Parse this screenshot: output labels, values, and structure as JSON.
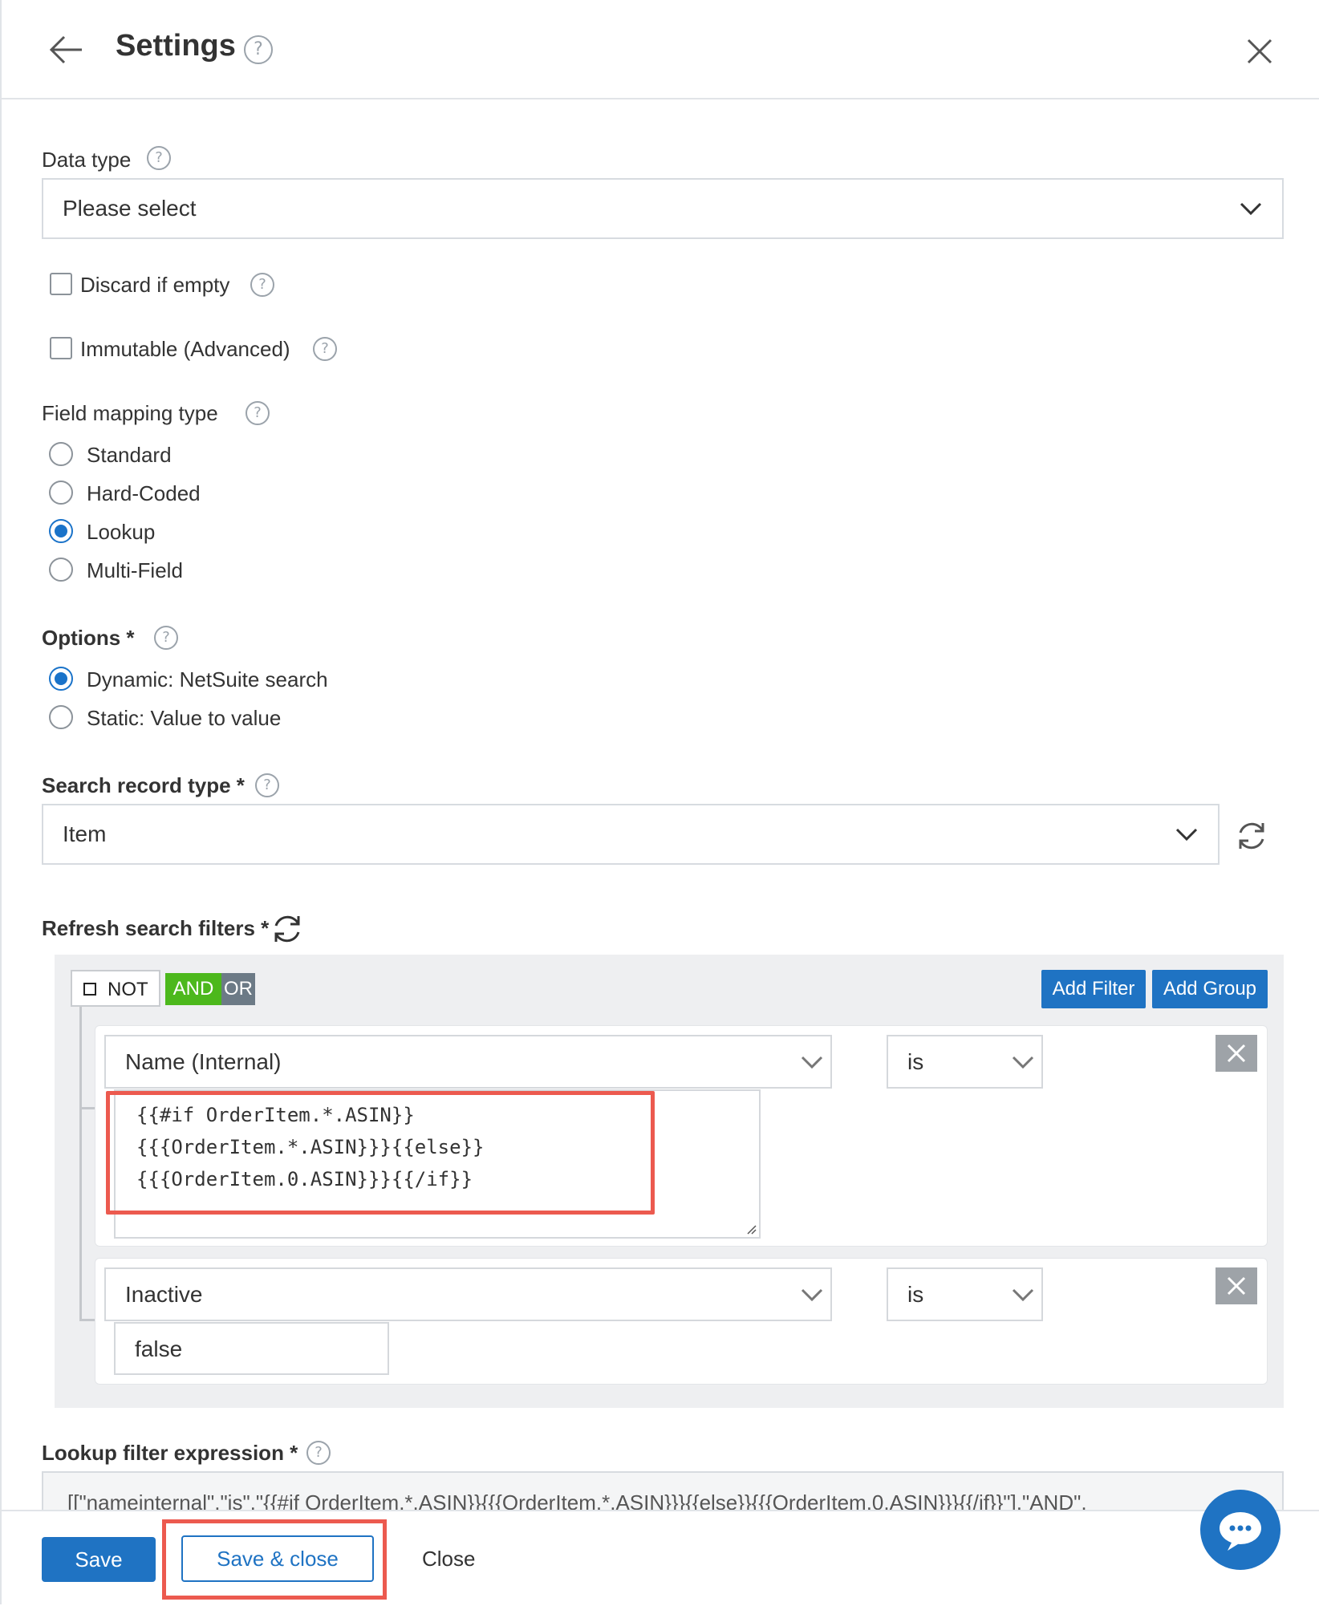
{
  "header": {
    "title": "Settings",
    "help": "?"
  },
  "data_type": {
    "label": "Data type",
    "help": "?",
    "value": "Please select"
  },
  "checkboxes": [
    {
      "label": "Discard if empty",
      "checked": false,
      "help": "?"
    },
    {
      "label": "Immutable (Advanced)",
      "checked": false,
      "help": "?"
    }
  ],
  "field_mapping": {
    "label": "Field mapping type",
    "help": "?",
    "options": [
      "Standard",
      "Hard-Coded",
      "Lookup",
      "Multi-Field"
    ],
    "selected": "Lookup"
  },
  "options_group": {
    "label": "Options *",
    "help": "?",
    "options": [
      "Dynamic: NetSuite search",
      "Static: Value to value"
    ],
    "selected": "Dynamic: NetSuite search"
  },
  "search_record": {
    "label": "Search record type *",
    "help": "?",
    "value": "Item"
  },
  "refresh_filters": {
    "label": "Refresh search filters *",
    "not_label": "NOT",
    "and_label": "AND",
    "or_label": "OR",
    "add_filter": "Add Filter",
    "add_group": "Add Group",
    "rules": [
      {
        "field": "Name (Internal)",
        "operator": "is",
        "value_lines": [
          "{{#if OrderItem.*.ASIN}}",
          "{{{OrderItem.*.ASIN}}}{{else}}",
          "{{{OrderItem.0.ASIN}}}{{/if}}"
        ]
      },
      {
        "field": "Inactive",
        "operator": "is",
        "value": "false"
      }
    ]
  },
  "lookup_expression": {
    "label": "Lookup filter expression *",
    "help": "?",
    "value": "[[\"nameinternal\",\"is\",\"{{#if OrderItem.*.ASIN}}{{{OrderItem.*.ASIN}}}{{else}}{{{OrderItem.0.ASIN}}}{{/if}}\"],\"AND\","
  },
  "footer": {
    "save": "Save",
    "save_close": "Save & close",
    "close": "Close"
  },
  "colors": {
    "primary": "#1f73c3",
    "and_green": "#4cb81c",
    "highlight_red": "#ec5a4f"
  },
  "icons": [
    "back-arrow-icon",
    "help-icon",
    "close-icon",
    "chevron-down-icon",
    "refresh-icon",
    "delete-icon",
    "chat-icon"
  ]
}
